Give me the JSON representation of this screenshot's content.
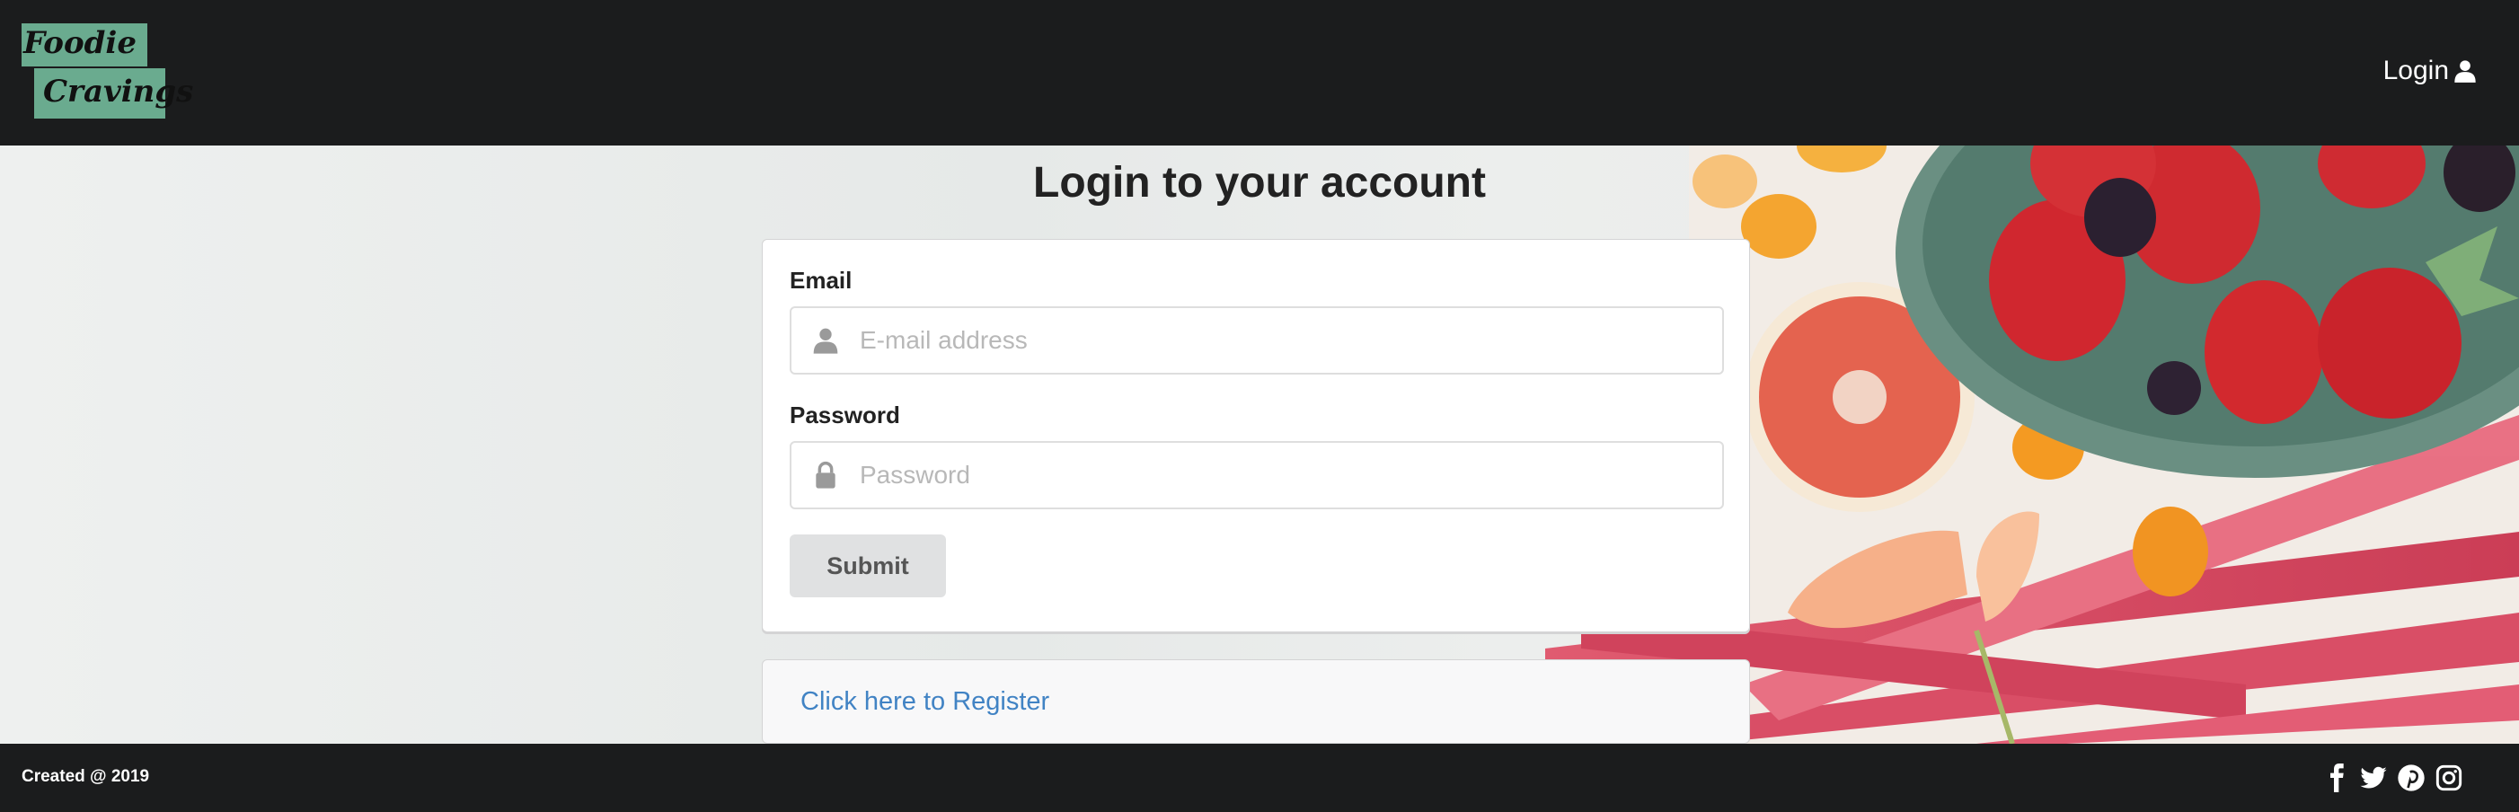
{
  "brand": {
    "logo_line1": "Foodie",
    "logo_line2": "Cravings"
  },
  "nav": {
    "login_label": "Login"
  },
  "page": {
    "title": "Login to your account"
  },
  "form": {
    "email_label": "Email",
    "email_placeholder": "E-mail address",
    "password_label": "Password",
    "password_placeholder": "Password",
    "submit_label": "Submit"
  },
  "register": {
    "link_text": "Click here to Register"
  },
  "footer": {
    "text": "Created @ 2019",
    "social_icons": [
      "facebook-icon",
      "twitter-icon",
      "pinterest-icon",
      "instagram-icon"
    ]
  },
  "colors": {
    "navbar_bg": "#1b1c1d",
    "logo_accent": "#6aab8f",
    "link": "#4183c4",
    "button_bg": "#e0e1e2"
  }
}
